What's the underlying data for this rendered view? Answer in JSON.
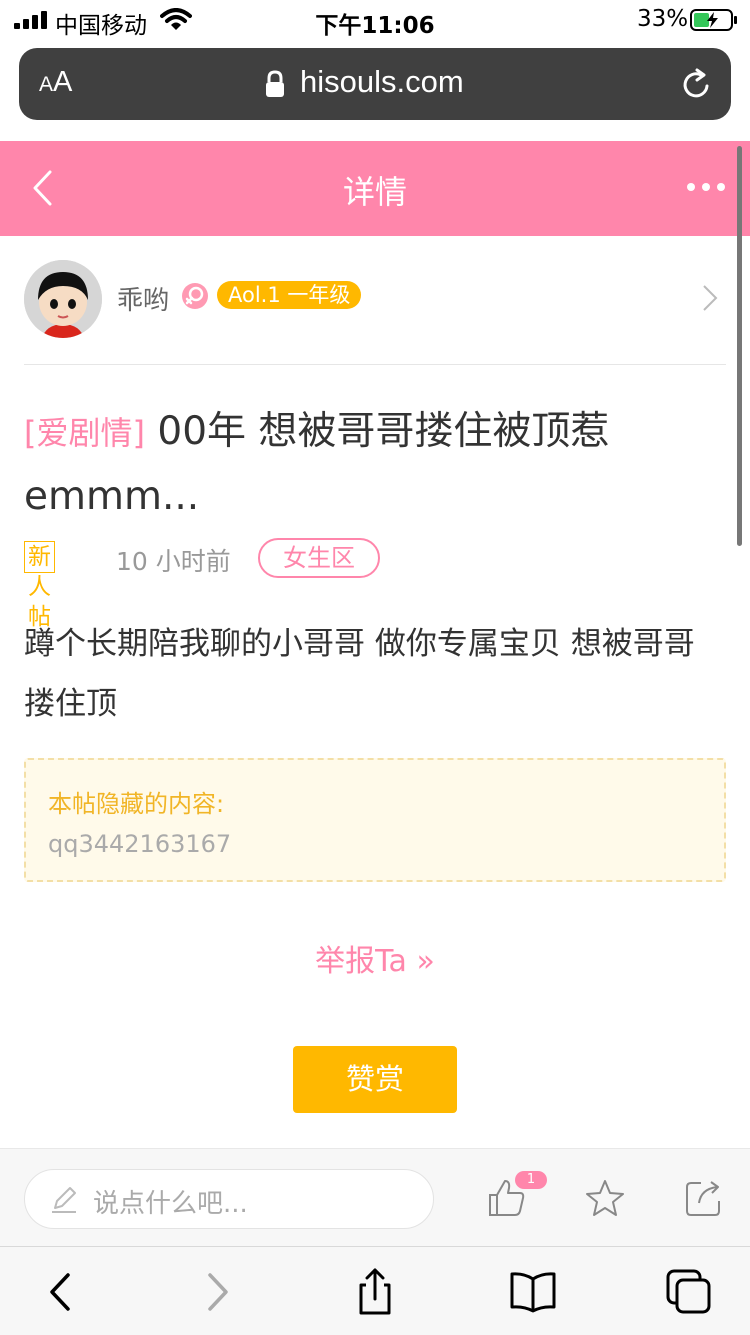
{
  "status_bar": {
    "carrier": "中国移动",
    "time": "下午11:06",
    "battery": "33%"
  },
  "browser": {
    "aa_small": "A",
    "aa_big": "A",
    "url": "hisouls.com"
  },
  "header": {
    "title": "详情"
  },
  "author": {
    "name": "乖哟",
    "level": "Aol.1 一年级"
  },
  "post": {
    "category_tag": "[爱剧情]",
    "title": " 00年 想被哥哥搂住被顶惹emmm...",
    "newbie_badge": "新人帖",
    "time": "10 小时前",
    "section": "女生区",
    "body": "蹲个长期陪我聊的小哥哥 做你专属宝贝  想被哥哥搂住顶",
    "hidden_label": "本帖隐藏的内容:",
    "hidden_value": "qq3442163167",
    "report_label": "举报Ta »",
    "reward_label": "赞赏"
  },
  "comment_bar": {
    "placeholder": "说点什么吧...",
    "like_count": "1"
  },
  "colors": {
    "brand_pink": "#ff86ab",
    "accent_yellow": "#ffb800"
  },
  "icons": {
    "signal": "cellular-signal-icon",
    "wifi": "wifi-icon",
    "battery": "battery-charging-icon",
    "lock": "lock-icon",
    "reload": "reload-icon",
    "back": "chevron-left-icon",
    "more": "more-dots-icon",
    "gender": "female-icon",
    "chevron": "chevron-right-icon",
    "pencil": "pencil-icon",
    "like": "thumbs-up-icon",
    "favorite": "star-icon",
    "share": "share-icon"
  }
}
